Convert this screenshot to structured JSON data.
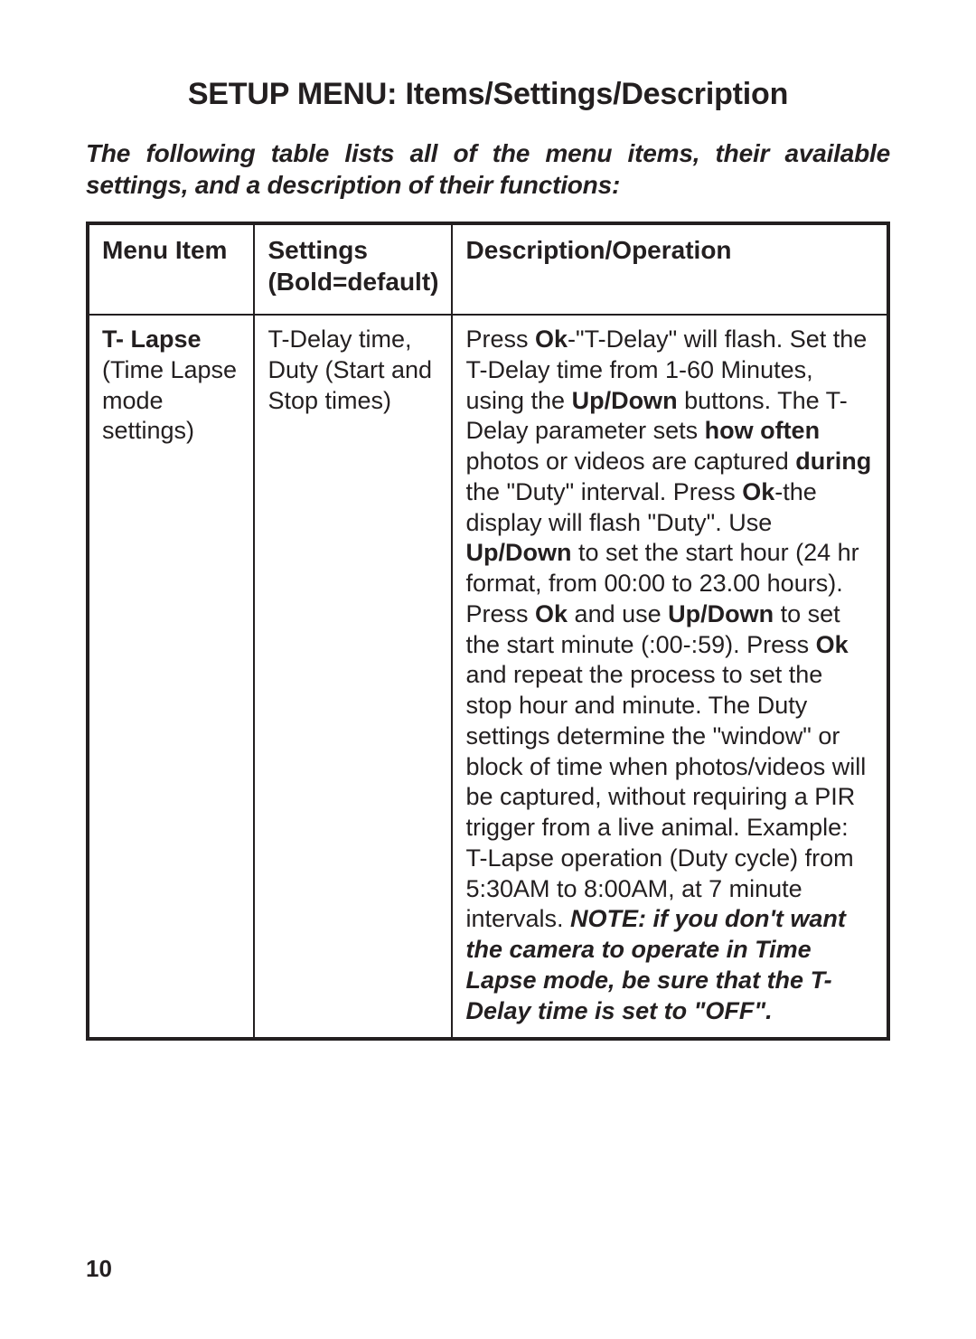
{
  "page": {
    "title": "SETUP MENU: Items/Settings/Description",
    "intro": "The following table lists all of the menu items, their available settings, and a description of their functions:",
    "page_number": "10"
  },
  "table": {
    "headers": {
      "col1": "Menu Item",
      "col2_line1": "Settings",
      "col2_line2": "(Bold=default)",
      "col3": "Description/Operation"
    },
    "rows": [
      {
        "menu_item": {
          "bold": "T- Lapse",
          "rest": "(Time Lapse mode settings)"
        },
        "settings": "T-Delay time, Duty (Start and Stop times)",
        "description": {
          "t1": "Press ",
          "b1": "Ok",
          "t2": "-\"T-Delay\" will flash. Set the T-Delay time from 1-60 Minutes, using the ",
          "b2": "Up/Down",
          "t3": " buttons. The T-Delay parameter sets ",
          "b3": "how often",
          "t4": " photos or videos are captured ",
          "b4": "during",
          "t5": " the \"Duty\" interval. Press ",
          "b5": "Ok",
          "t6": "-the display will flash \"Duty\". Use ",
          "b6": "Up/Down",
          "t7": " to set the start hour (24 hr format, from 00:00 to 23.00 hours). Press ",
          "b7": "Ok",
          "t8": " and use ",
          "b8": "Up/Down",
          "t9": " to set the start minute (:00-:59). Press ",
          "b9": "Ok",
          "t10": " and repeat the process to set the stop hour and minute.  The Duty settings determine the \"window\" or block of time when photos/videos will be captured, without requiring a PIR trigger from a live animal. Example: T-Lapse operation (Duty cycle) from 5:30AM to 8:00AM, at 7 minute intervals. ",
          "note": "NOTE: if you don't want the camera to operate in Time Lapse mode, be sure that the T-Delay time is set to \"OFF\"."
        }
      }
    ]
  }
}
